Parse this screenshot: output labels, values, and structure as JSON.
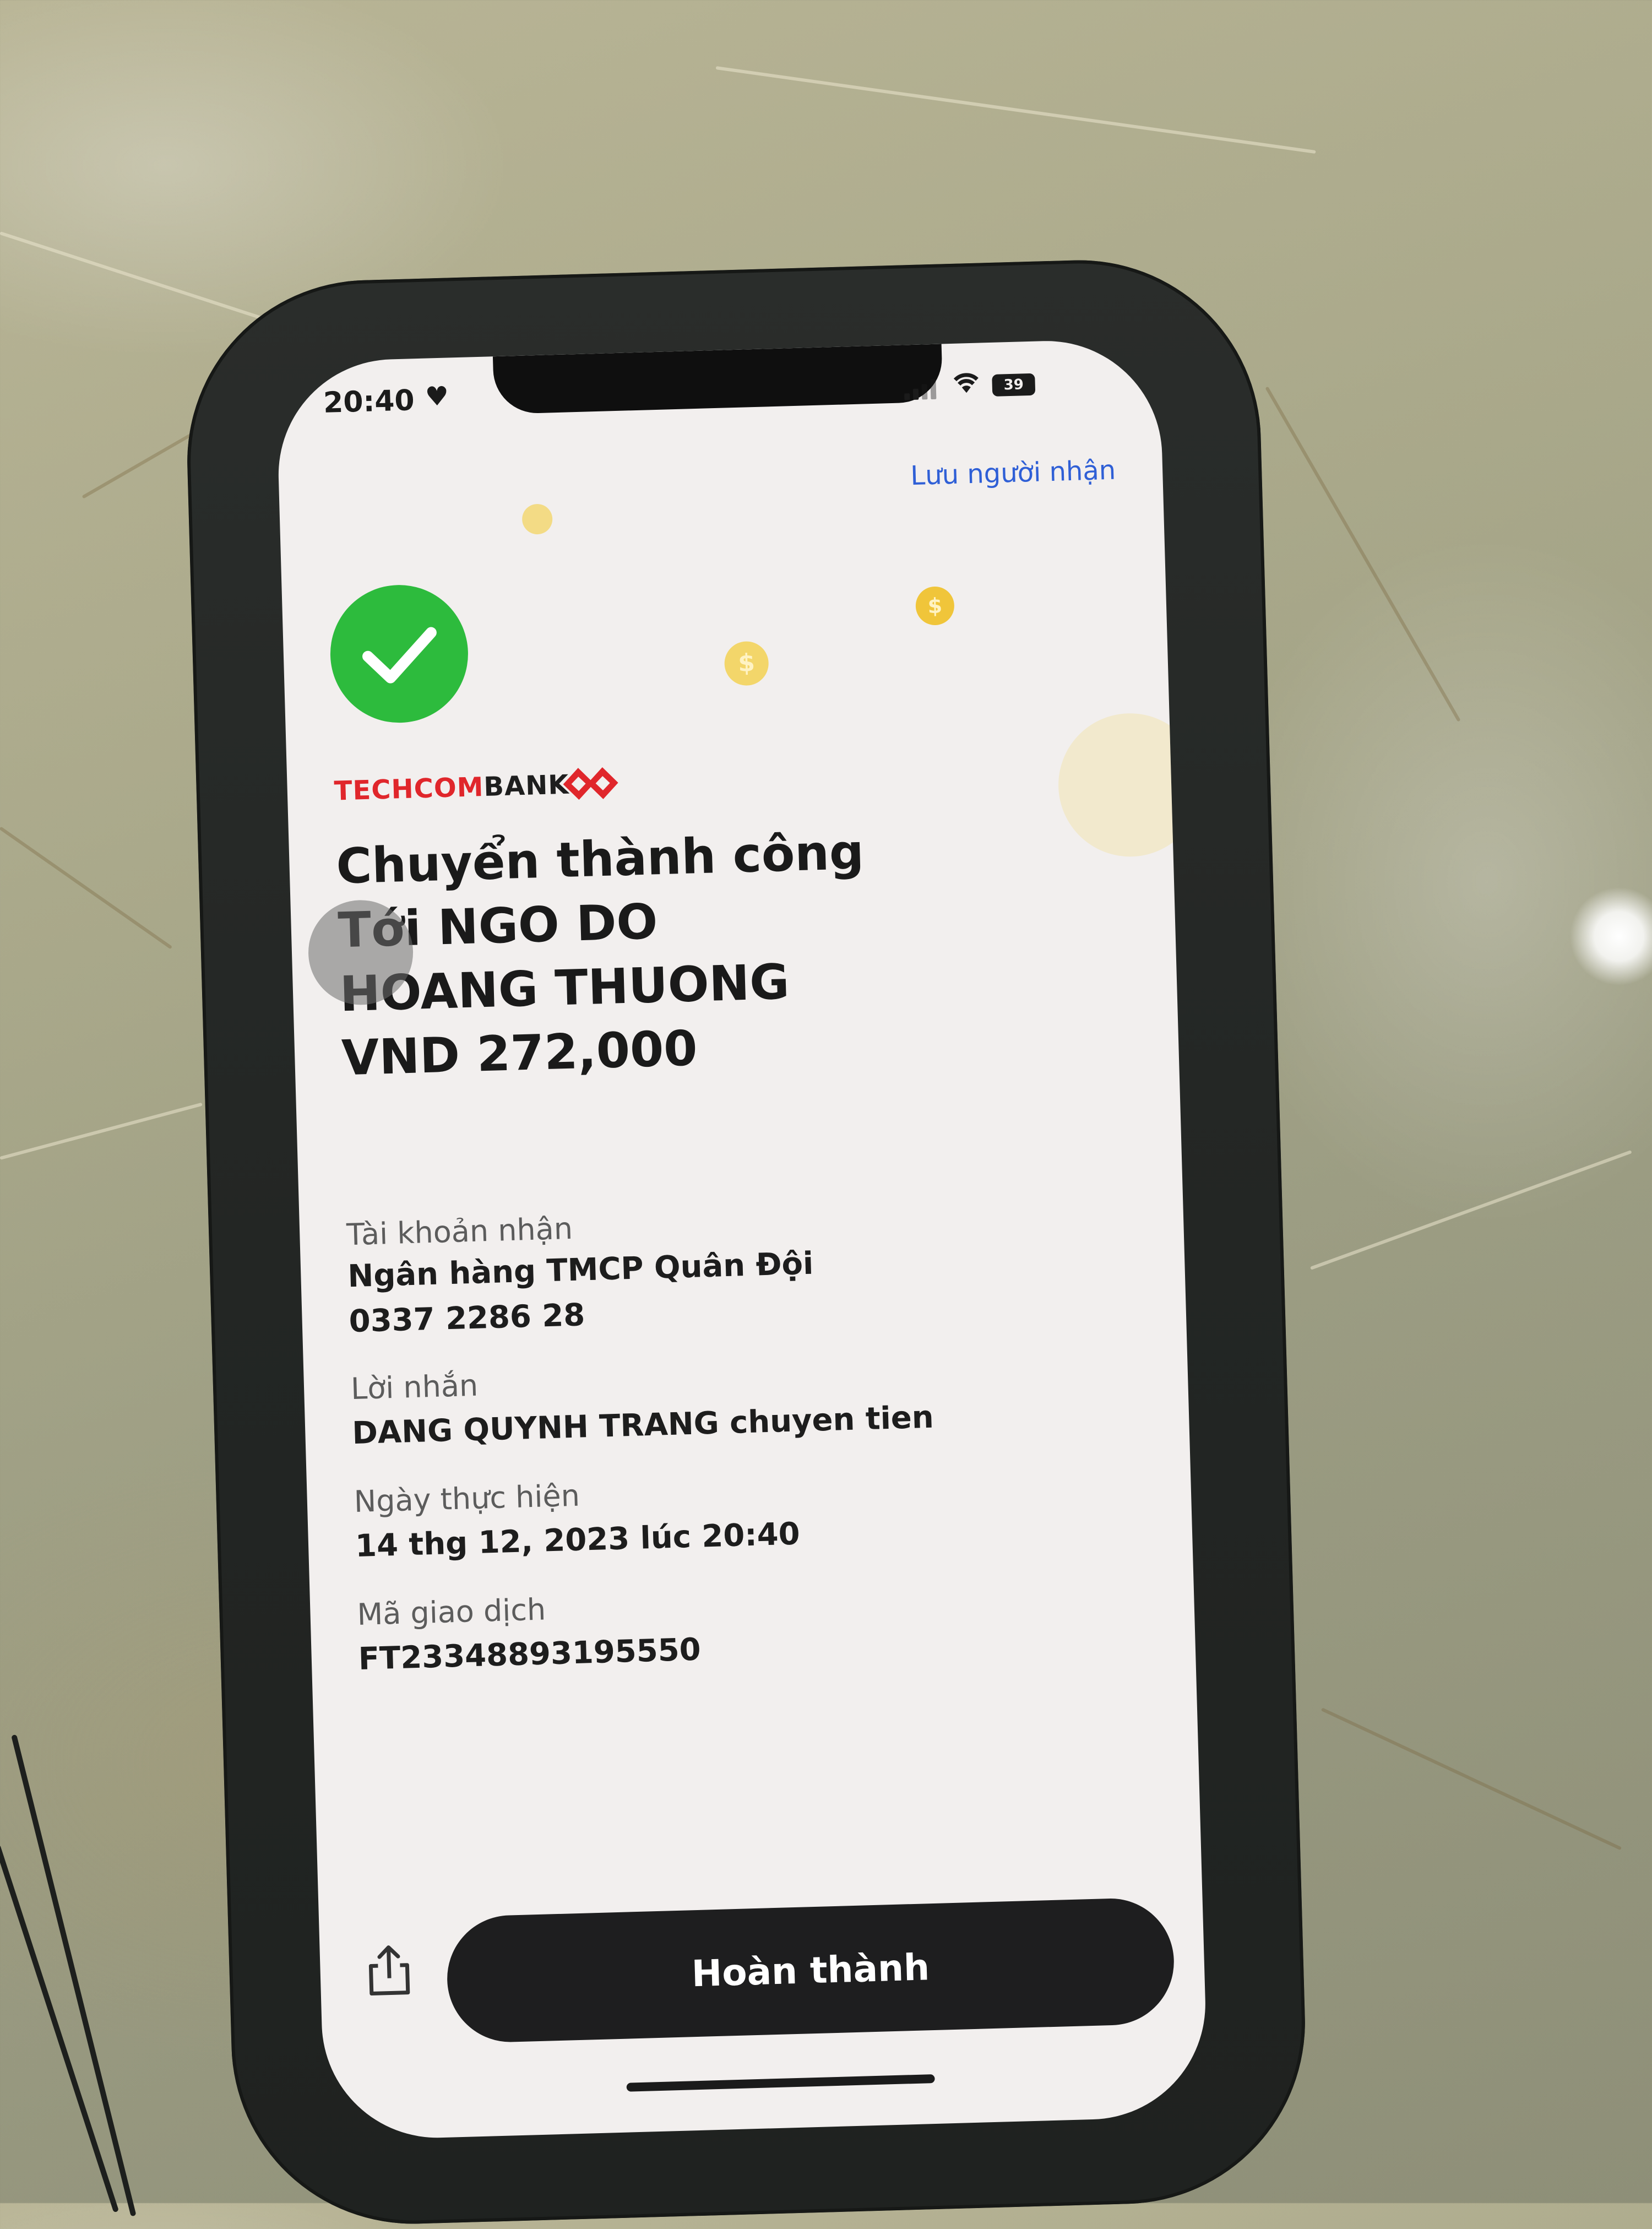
{
  "status_bar": {
    "time": "20:40",
    "heart_icon": "heart",
    "battery": "39"
  },
  "header": {
    "save_recipient_label": "Lưu người nhận"
  },
  "brand": {
    "name_part1": "TECHCOM",
    "name_part2": "BANK",
    "accent_color": "#e0262b"
  },
  "result": {
    "status_line": "Chuyển thành công",
    "recipient_line1": "Tới NGO DO",
    "recipient_line2": "HOANG THUONG",
    "amount": "VND 272,000"
  },
  "details": {
    "account_label": "Tài khoản nhận",
    "bank_name": "Ngân hàng TMCP Quân Đội",
    "account_number": "0337 2286 28",
    "message_label": "Lời nhắn",
    "message": "DANG QUYNH TRANG chuyen tien",
    "date_label": "Ngày thực hiện",
    "date": "14 thg 12, 2023 lúc 20:40",
    "txn_label": "Mã giao dịch",
    "txn_id": "FT23348893195550"
  },
  "footer": {
    "done_label": "Hoàn thành",
    "success_color": "#2dbb3d",
    "button_color": "#1e1e1f"
  }
}
